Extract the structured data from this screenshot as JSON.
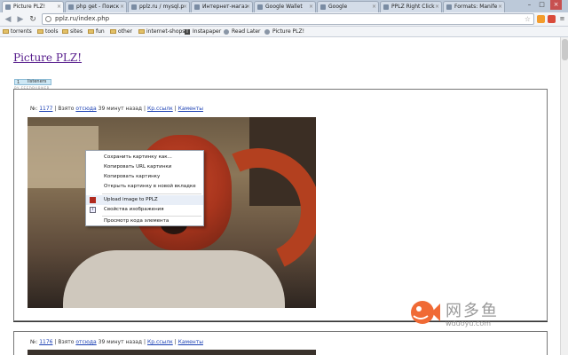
{
  "browser": {
    "tabs": [
      {
        "label": "Picture PLZ!",
        "active": true
      },
      {
        "label": "php get - Поиск"
      },
      {
        "label": "pplz.ru / mysql.p"
      },
      {
        "label": "Интернет-магаз"
      },
      {
        "label": "Google Wallet"
      },
      {
        "label": "Google"
      },
      {
        "label": "PPLZ Right Click"
      },
      {
        "label": "Formats: Manife"
      }
    ],
    "tab_close_glyph": "×",
    "window_controls": [
      "–",
      "□",
      "×"
    ],
    "nav": {
      "back": "◀",
      "forward": "▶",
      "reload": "↻"
    },
    "address": "pplz.ru/index.php",
    "star_glyph": "☆",
    "wrench_glyph": "≡",
    "bookmarks": [
      {
        "label": "torrents",
        "type": "folder"
      },
      {
        "label": "tools",
        "type": "folder"
      },
      {
        "label": "sites",
        "type": "folder"
      },
      {
        "label": "fun",
        "type": "folder"
      },
      {
        "label": "other",
        "type": "folder"
      },
      {
        "label": "internet-shops",
        "type": "folder"
      },
      {
        "label": "Instapaper",
        "type": "page"
      },
      {
        "label": "Read Later",
        "type": "page"
      },
      {
        "label": "Picture PLZ!",
        "type": "page"
      }
    ]
  },
  "page": {
    "title": "Picture PLZ!",
    "widget_count": "1",
    "widget_label": "listeners",
    "widget_sub": "BY FEEDBURNER"
  },
  "posts": [
    {
      "num_label": "№:",
      "num": "1177",
      "taken_label": "Взято",
      "taken_link": "отсюда",
      "time": "39 минут назад",
      "short_link": "Кр.ссылк",
      "comments": "Каменты",
      "sep": "|"
    },
    {
      "num_label": "№:",
      "num": "1176",
      "taken_label": "Взято",
      "taken_link": "отсюда",
      "time": "39 минут назад",
      "short_link": "Кр.ссылк",
      "comments": "Каменты",
      "sep": "|"
    }
  ],
  "context_menu": {
    "items": [
      "Сохранить картинку как...",
      "Копировать URL картинки",
      "Копировать картинку",
      "Открыть картинку в новой вкладке",
      "Upload image to PPLZ",
      "Свойства изображения",
      "Просмотр кода элемента"
    ],
    "highlighted_index": 4
  },
  "watermark": {
    "cn": "网多鱼",
    "url": "wduoyu.com"
  },
  "colors": {
    "link": "#1a3fb3",
    "visited": "#551a8b",
    "fish": "#f06a35"
  }
}
